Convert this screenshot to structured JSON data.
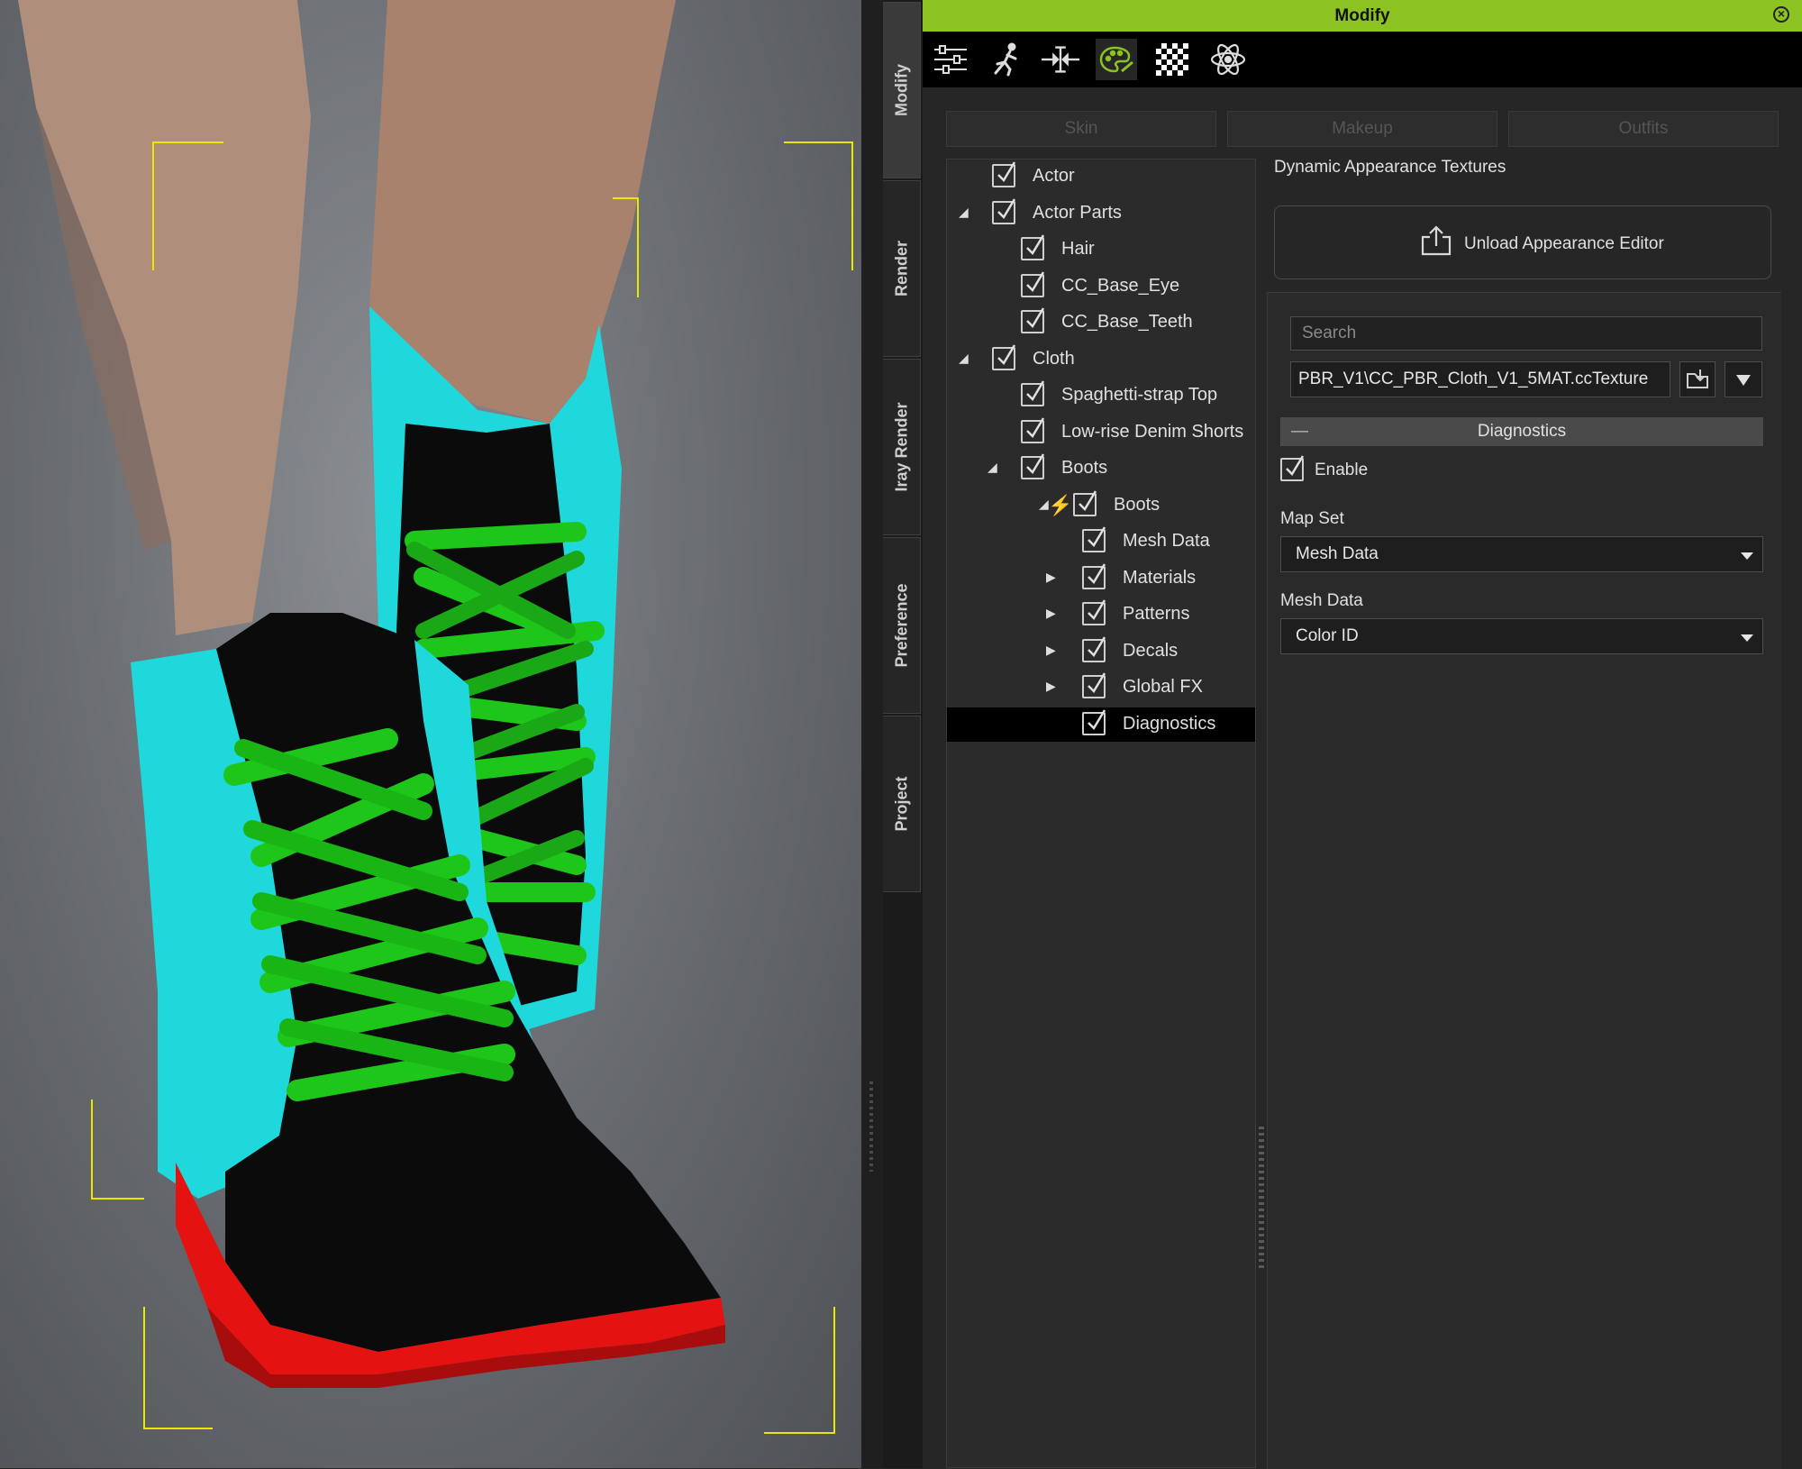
{
  "panel": {
    "title": "Modify",
    "side_tabs": [
      "Modify",
      "Render",
      "Iray Render",
      "Preference",
      "Project"
    ],
    "toolbar_icons": [
      "sliders-icon",
      "pose-icon",
      "morph-icon",
      "appearance-palette-icon",
      "checker-texture-icon",
      "physics-atom-icon"
    ],
    "sub_tabs": [
      "Skin",
      "Makeup",
      "Outfits"
    ],
    "accent": "#8cc322"
  },
  "tree": [
    {
      "label": "Actor",
      "checked": true
    },
    {
      "label": "Actor Parts",
      "checked": true,
      "expanded": true
    },
    {
      "label": "Hair",
      "checked": true
    },
    {
      "label": "CC_Base_Eye",
      "checked": true
    },
    {
      "label": "CC_Base_Teeth",
      "checked": true
    },
    {
      "label": "Cloth",
      "checked": true,
      "expanded": true
    },
    {
      "label": "Spaghetti-strap Top",
      "checked": true
    },
    {
      "label": "Low-rise Denim Shorts",
      "checked": true
    },
    {
      "label": "Boots",
      "checked": true,
      "expanded": true
    },
    {
      "label": "Boots",
      "checked": true,
      "expanded": true
    },
    {
      "label": "Mesh Data",
      "checked": true
    },
    {
      "label": "Materials",
      "checked": true,
      "expanded": false
    },
    {
      "label": "Patterns",
      "checked": true,
      "expanded": false
    },
    {
      "label": "Decals",
      "checked": true,
      "expanded": false
    },
    {
      "label": "Global FX",
      "checked": true,
      "expanded": false
    },
    {
      "label": "Diagnostics",
      "checked": true,
      "selected": true
    }
  ],
  "right": {
    "section_title": "Dynamic Appearance Textures",
    "unload_button": "Unload Appearance Editor",
    "search_placeholder": "Search",
    "texture_path": "PBR_V1\\CC_PBR_Cloth_V1_5MAT.ccTexture",
    "group_title": "Diagnostics",
    "collapse_symbol": "—",
    "enable_label": "Enable",
    "enable_checked": true,
    "map_set_label": "Map Set",
    "map_set_value": "Mesh Data",
    "mesh_data_label": "Mesh Data",
    "mesh_data_value": "Color ID"
  },
  "viewport": {
    "boot_colors": {
      "shaft": "#1fd8dc",
      "upper": "#0a0a0a",
      "laces": "#1fc61a",
      "sole": "#e51212"
    },
    "selection_bracket_color": "#e8e800"
  }
}
